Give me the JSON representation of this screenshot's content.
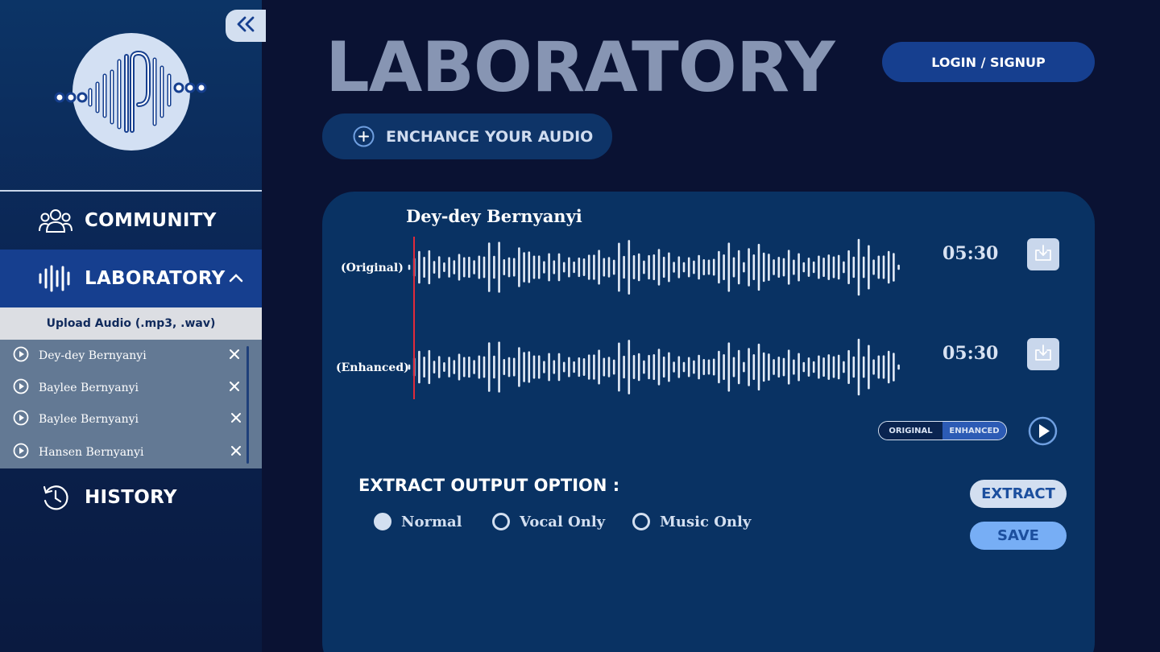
{
  "sidebar": {
    "nav": {
      "community": "COMMUNITY",
      "laboratory": "LABORATORY",
      "history": "HISTORY"
    },
    "upload_label": "Upload Audio (.mp3, .wav)",
    "files": [
      {
        "name": "Dey-dey Bernyanyi"
      },
      {
        "name": "Baylee Bernyanyi"
      },
      {
        "name": "Baylee Bernyanyi"
      },
      {
        "name": "Hansen Bernyanyi"
      }
    ]
  },
  "header": {
    "title": "LABORATORY",
    "login_label": "LOGIN / SIGNUP",
    "enhance_label": "ENCHANCE YOUR AUDIO"
  },
  "player": {
    "track_title": "Dey-dey Bernyanyi",
    "original_label": "(Original)",
    "enhanced_label": "(Enhanced)",
    "original_time": "05:30",
    "enhanced_time": "05:30",
    "toggle": {
      "original": "ORIGINAL",
      "enhanced": "ENHANCED",
      "selected": "ENHANCED"
    }
  },
  "extract": {
    "title": "EXTRACT OUTPUT OPTION :",
    "options": [
      {
        "label": "Normal",
        "selected": true
      },
      {
        "label": "Vocal Only",
        "selected": false
      },
      {
        "label": "Music Only",
        "selected": false
      }
    ],
    "extract_label": "EXTRACT",
    "save_label": "SAVE"
  },
  "colors": {
    "background": "#0a1233",
    "sidebar_active": "#163f8f",
    "panel": "#093263",
    "title_muted": "#8795b3",
    "playhead": "#e02a3a",
    "save_button": "#77aef5"
  },
  "icons": {
    "collapse": "double-chevron-left-icon",
    "community": "users-group-icon",
    "laboratory": "audio-bars-icon",
    "history": "history-clock-icon",
    "enhance": "plus-circle-icon",
    "download": "download-icon",
    "play": "play-circle-icon",
    "close": "close-icon"
  }
}
